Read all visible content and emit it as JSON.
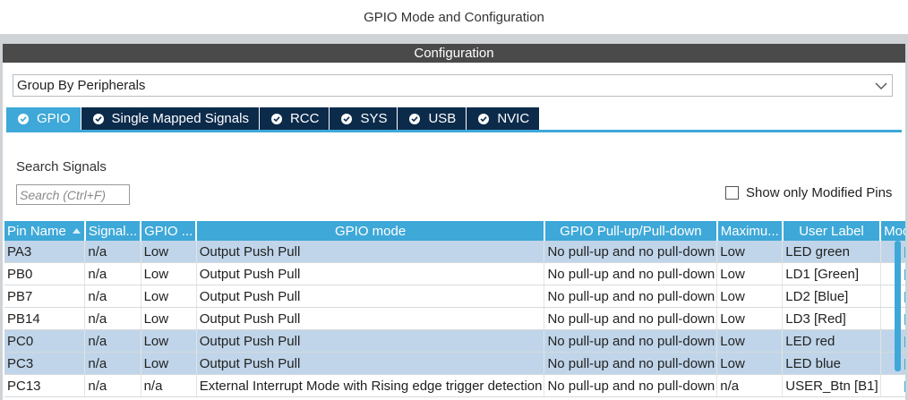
{
  "window": {
    "title": "GPIO Mode and Configuration"
  },
  "config": {
    "header": "Configuration",
    "group_by": "Group By Peripherals",
    "tabs": [
      {
        "label": "GPIO",
        "active": true
      },
      {
        "label": "Single Mapped Signals",
        "active": false
      },
      {
        "label": "RCC",
        "active": false
      },
      {
        "label": "SYS",
        "active": false
      },
      {
        "label": "USB",
        "active": false
      },
      {
        "label": "NVIC",
        "active": false
      }
    ]
  },
  "search": {
    "label": "Search Signals",
    "placeholder": "Search (Ctrl+F)"
  },
  "filter": {
    "show_modified_label": "Show only Modified Pins",
    "checked": false
  },
  "table": {
    "columns": [
      "Pin Name",
      "Signal...",
      "GPIO ...",
      "GPIO mode",
      "GPIO Pull-up/Pull-down",
      "Maximu...",
      "User Label",
      "Modified"
    ],
    "rows": [
      {
        "pin": "PA3",
        "signal": "n/a",
        "gpio": "Low",
        "mode": "Output Push Pull",
        "pull": "No pull-up and no pull-down",
        "max": "Low",
        "label": "LED green",
        "modified": true,
        "selected": true
      },
      {
        "pin": "PB0",
        "signal": "n/a",
        "gpio": "Low",
        "mode": "Output Push Pull",
        "pull": "No pull-up and no pull-down",
        "max": "Low",
        "label": "LD1 [Green]",
        "modified": true,
        "selected": false
      },
      {
        "pin": "PB7",
        "signal": "n/a",
        "gpio": "Low",
        "mode": "Output Push Pull",
        "pull": "No pull-up and no pull-down",
        "max": "Low",
        "label": "LD2 [Blue]",
        "modified": true,
        "selected": false
      },
      {
        "pin": "PB14",
        "signal": "n/a",
        "gpio": "Low",
        "mode": "Output Push Pull",
        "pull": "No pull-up and no pull-down",
        "max": "Low",
        "label": "LD3 [Red]",
        "modified": true,
        "selected": false
      },
      {
        "pin": "PC0",
        "signal": "n/a",
        "gpio": "Low",
        "mode": "Output Push Pull",
        "pull": "No pull-up and no pull-down",
        "max": "Low",
        "label": "LED red",
        "modified": true,
        "selected": true
      },
      {
        "pin": "PC3",
        "signal": "n/a",
        "gpio": "Low",
        "mode": "Output Push Pull",
        "pull": "No pull-up and no pull-down",
        "max": "Low",
        "label": "LED blue",
        "modified": true,
        "selected": true
      },
      {
        "pin": "PC13",
        "signal": "n/a",
        "gpio": "n/a",
        "mode": "External Interrupt Mode with Rising edge trigger detection",
        "pull": "No pull-up and no pull-down",
        "max": "n/a",
        "label": "USER_Btn [B1]",
        "modified": true,
        "selected": false
      }
    ]
  },
  "colors": {
    "accent": "#3ea8d8",
    "tab_inactive": "#0c2b4b",
    "selected_row": "#c0d5e9",
    "header_bar": "#4a4a4a"
  },
  "icons": {
    "tab_check": "check-circle-icon",
    "sort": "sort-icon",
    "dropdown": "chevron-down-icon",
    "modified": "checkbox-checked-icon"
  }
}
